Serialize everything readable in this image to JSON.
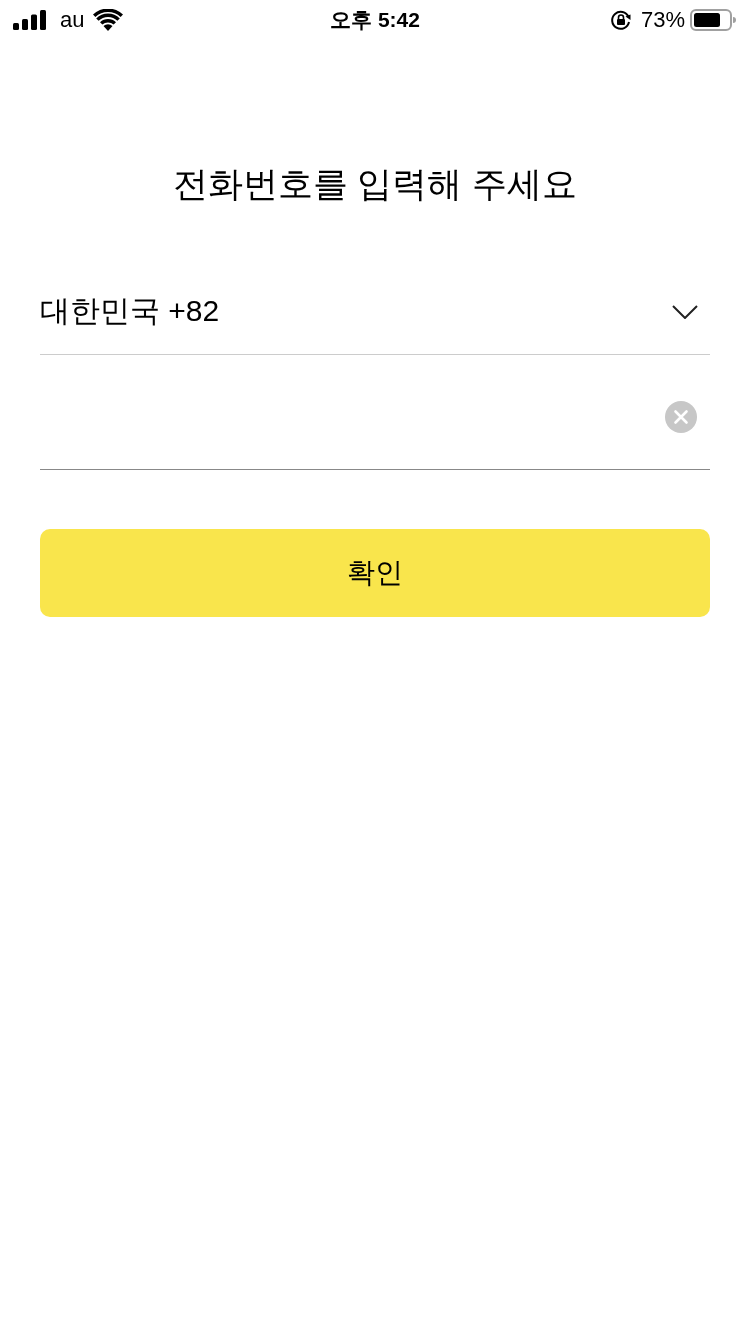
{
  "status_bar": {
    "carrier": "au",
    "time": "오후 5:42",
    "battery": "73%"
  },
  "title": "전화번호를 입력해 주세요",
  "country_select": {
    "value": "대한민국 +82"
  },
  "phone_field": {
    "clearable": true
  },
  "confirm_button": {
    "label": "확인"
  }
}
